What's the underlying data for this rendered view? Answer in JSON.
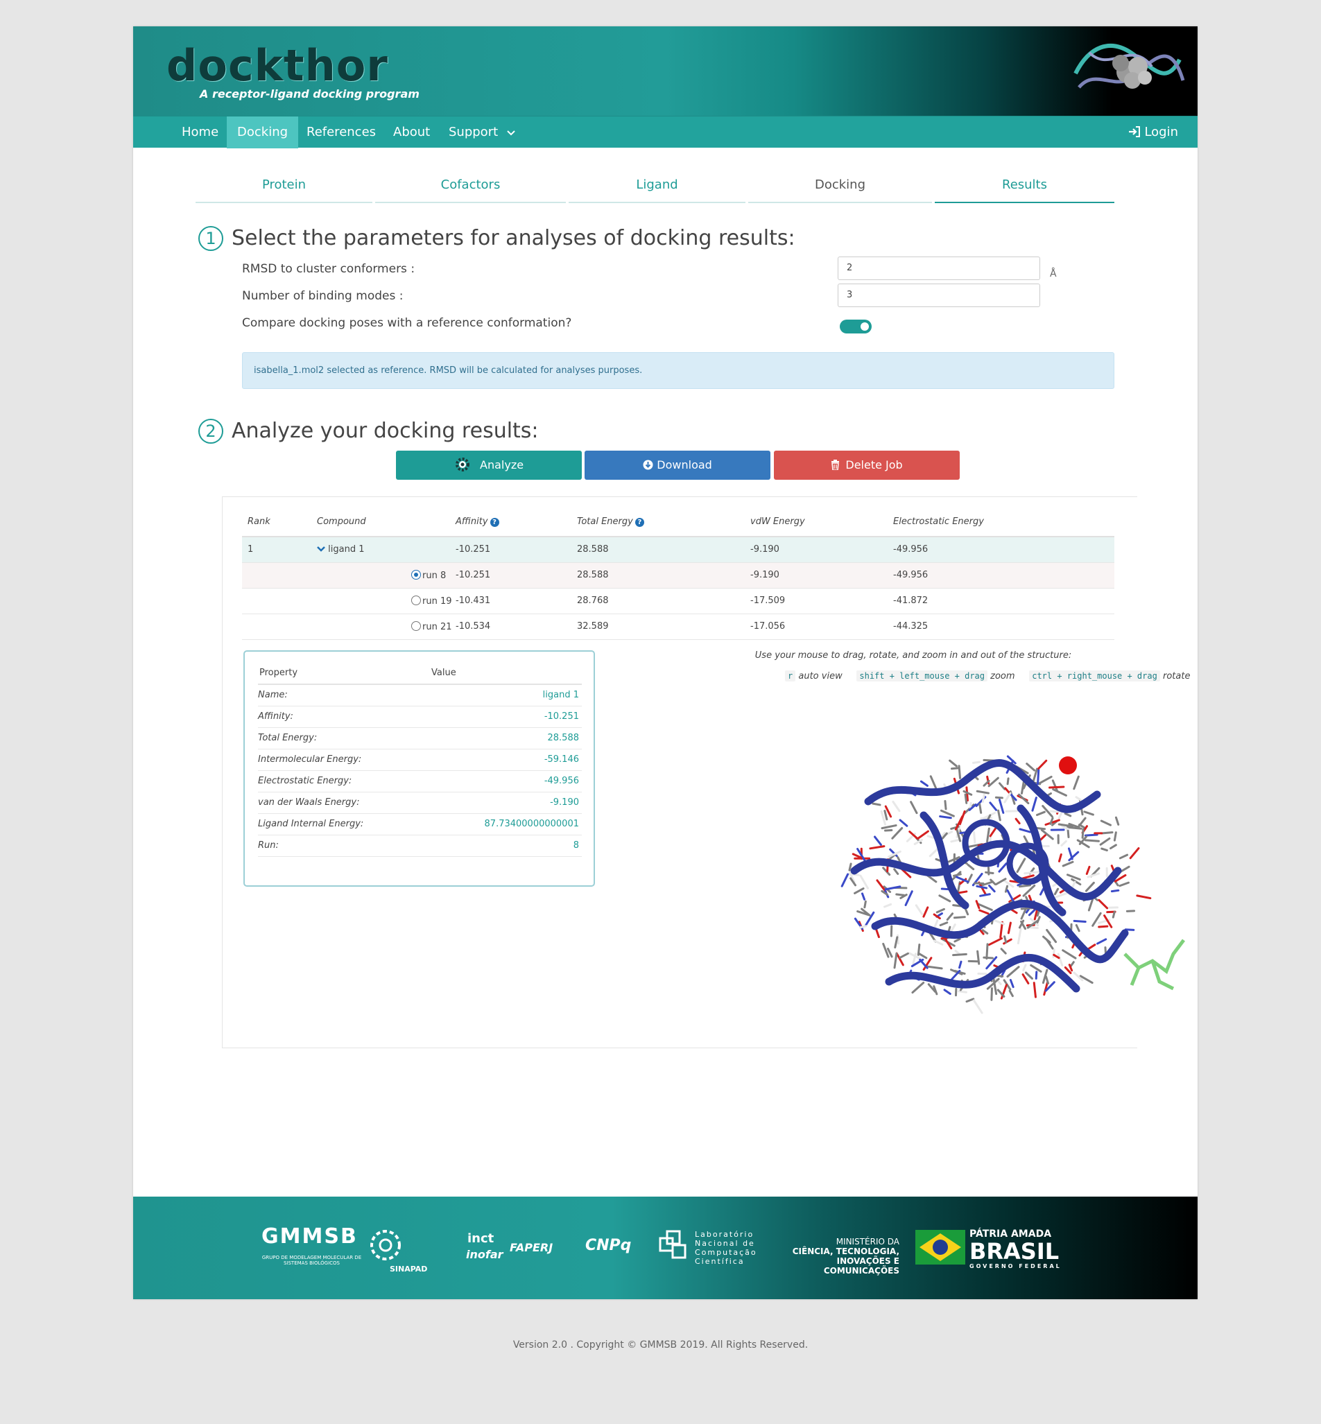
{
  "header": {
    "logo": "dockthor",
    "tagline": "A receptor-ligand docking program"
  },
  "nav": {
    "items": [
      "Home",
      "Docking",
      "References",
      "About",
      "Support"
    ],
    "active": "Docking",
    "login": "Login"
  },
  "steps": [
    "Protein",
    "Cofactors",
    "Ligand",
    "Docking",
    "Results"
  ],
  "section1": {
    "number": "1",
    "title": "Select the parameters for analyses of docking results:",
    "rmsd_label": "RMSD to cluster conformers :",
    "rmsd_value": "2",
    "rmsd_unit": "Å",
    "modes_label": "Number of binding modes :",
    "modes_value": "3",
    "compare_label": "Compare docking poses with a reference conformation?",
    "compare_on": true,
    "alert": "isabella_1.mol2 selected as reference. RMSD will be calculated for analyses purposes."
  },
  "section2": {
    "number": "2",
    "title": "Analyze your docking results:",
    "analyze": "Analyze",
    "download": "Download",
    "delete": "Delete Job"
  },
  "results": {
    "headers": [
      "Rank",
      "Compound",
      "Affinity",
      "Total Energy",
      "vdW Energy",
      "Electrostatic Energy"
    ],
    "ligand": {
      "rank": "1",
      "name": "ligand 1",
      "affinity": "-10.251",
      "total": "28.588",
      "vdw": "-9.190",
      "elec": "-49.956"
    },
    "runs": [
      {
        "name": "run 8",
        "affinity": "-10.251",
        "total": "28.588",
        "vdw": "-9.190",
        "elec": "-49.956",
        "checked": true
      },
      {
        "name": "run 19",
        "affinity": "-10.431",
        "total": "28.768",
        "vdw": "-17.509",
        "elec": "-41.872",
        "checked": false
      },
      {
        "name": "run 21",
        "affinity": "-10.534",
        "total": "32.589",
        "vdw": "-17.056",
        "elec": "-44.325",
        "checked": false
      }
    ]
  },
  "properties": {
    "header_property": "Property",
    "header_value": "Value",
    "rows": [
      {
        "name": "Name:",
        "value": "ligand 1"
      },
      {
        "name": "Affinity:",
        "value": "-10.251"
      },
      {
        "name": "Total Energy:",
        "value": "28.588"
      },
      {
        "name": "Intermolecular Energy:",
        "value": "-59.146"
      },
      {
        "name": "Electrostatic Energy:",
        "value": "-49.956"
      },
      {
        "name": "van der Waals Energy:",
        "value": "-9.190"
      },
      {
        "name": "Ligand Internal Energy:",
        "value": "87.73400000000001"
      },
      {
        "name": "Run:",
        "value": "8"
      }
    ]
  },
  "viewer": {
    "hint": "Use your mouse to drag, rotate, and zoom in and out of the structure:",
    "key1": "r",
    "key1_action": "auto view",
    "key2": "shift + left_mouse + drag",
    "key2_action": "zoom",
    "key3": "ctrl + right_mouse + drag",
    "key3_action": "rotate"
  },
  "footer": {
    "logos": [
      "GMMSB",
      "GRUPO DE MODELAGEM MOLECULAR DE SISTEMAS BIOLÓGICOS",
      "SINAPAD",
      "inct",
      "inofar",
      "FAPERJ",
      "CNPq",
      "Laboratório Nacional de Computação Científica",
      "MINISTÉRIO DA",
      "CIÊNCIA, TECNOLOGIA,",
      "INOVAÇÕES E COMUNICAÇÕES",
      "PÁTRIA AMADA",
      "BRASIL",
      "GOVERNO FEDERAL"
    ],
    "copyright": "Version 2.0 . Copyright © GMMSB 2019. All Rights Reserved."
  },
  "colors": {
    "teal": "#1e9c96",
    "blue": "#3779be",
    "red": "#d9534f"
  }
}
